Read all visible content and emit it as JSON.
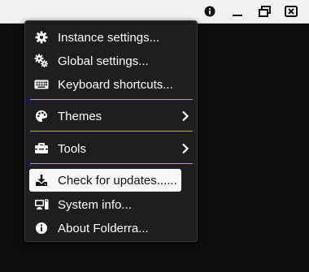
{
  "window": {
    "controls": [
      {
        "name": "info",
        "icon": "info-icon"
      },
      {
        "name": "minimize",
        "icon": "minimize-icon"
      },
      {
        "name": "restore",
        "icon": "restore-icon"
      },
      {
        "name": "close",
        "icon": "close-icon"
      }
    ]
  },
  "menu": {
    "items": [
      {
        "label": "Instance settings...",
        "icon": "gear-icon"
      },
      {
        "label": "Global settings...",
        "icon": "gears-icon"
      },
      {
        "label": "Keyboard shortcuts...",
        "icon": "keyboard-icon"
      },
      {
        "label": "Themes",
        "icon": "palette-icon",
        "submenu": true
      },
      {
        "label": "Tools",
        "icon": "toolbox-icon",
        "submenu": true
      },
      {
        "label": "Check for updates......",
        "icon": "download-icon",
        "highlighted": true
      },
      {
        "label": "System info...",
        "icon": "computer-icon"
      },
      {
        "label": "About Folderra...",
        "icon": "info-circle-icon"
      }
    ]
  },
  "colors": {
    "menu_bg": "#1e1e1e",
    "separator": "#b5b52a",
    "highlight_bg": "#f7f7f7",
    "text": "#ffffff"
  }
}
